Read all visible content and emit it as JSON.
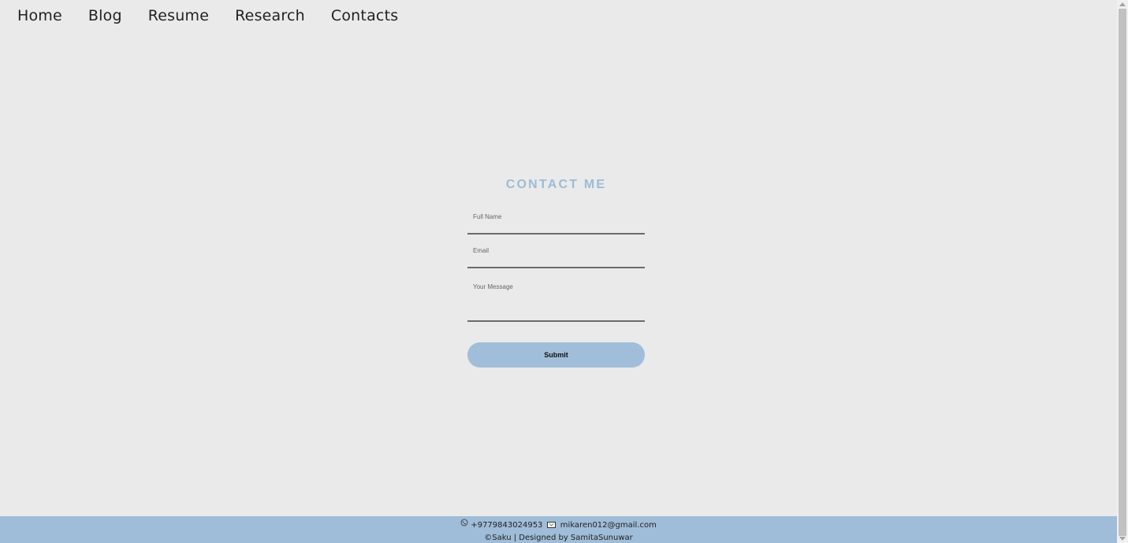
{
  "nav": {
    "items": [
      {
        "label": "Home"
      },
      {
        "label": "Blog"
      },
      {
        "label": "Resume"
      },
      {
        "label": "Research"
      },
      {
        "label": "Contacts"
      }
    ]
  },
  "contact": {
    "title": "CONTACT ME",
    "name_placeholder": "Full Name",
    "email_placeholder": "Email",
    "message_placeholder": "Your Message",
    "submit_label": "Submit"
  },
  "footer": {
    "phone": "+9779843024953",
    "email": "mikaren012@gmail.com",
    "credit": "©Saku | Designed by SamitaSunuwar",
    "phone_icon": "phone-icon",
    "mail_icon": "mail-icon"
  },
  "colors": {
    "accent": "#9fbcd8",
    "title": "#9bbcd6",
    "background": "#eaeaea"
  }
}
